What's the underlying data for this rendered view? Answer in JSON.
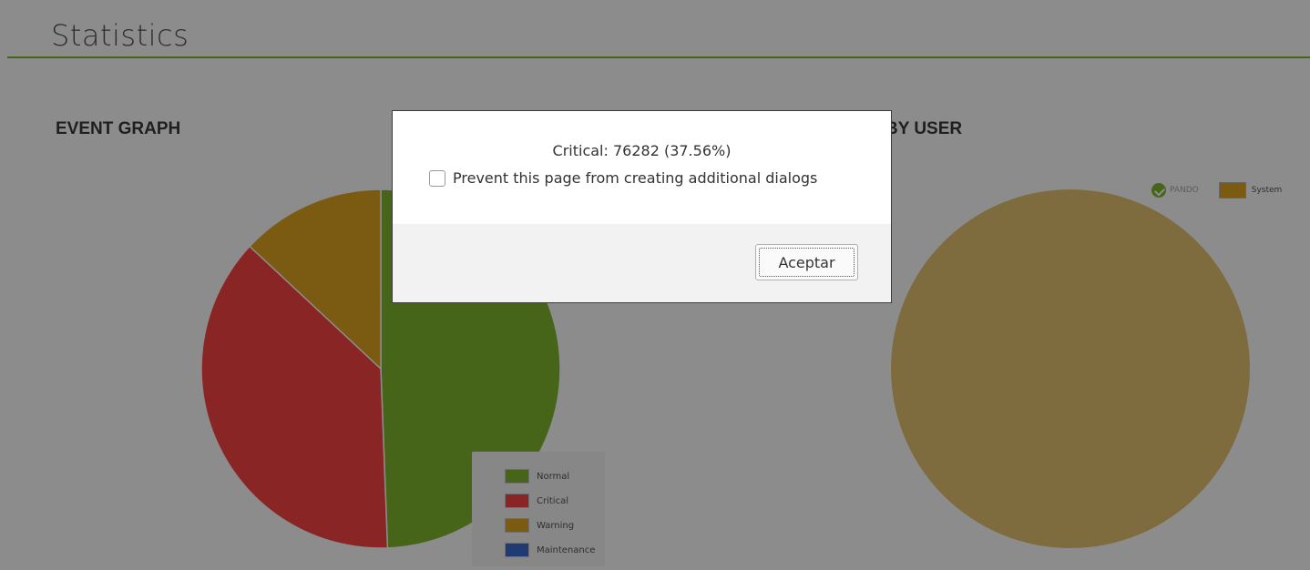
{
  "page": {
    "title": "Statistics",
    "accent_color": "#82b92e"
  },
  "sections": {
    "event_graph_title": "EVENT GRAPH",
    "by_user_title": "BY USER"
  },
  "chart_data": [
    {
      "type": "pie",
      "title": "EVENT GRAPH",
      "categories": [
        "Normal",
        "Critical",
        "Warning",
        "Maintenance"
      ],
      "values": [
        49.4,
        37.56,
        13.04,
        0
      ],
      "colors": [
        "#82b92e",
        "#fc4444",
        "#e0a521",
        "#3b6bd4"
      ],
      "legend_position": "bottom-right"
    },
    {
      "type": "pie",
      "title": "BY USER",
      "categories": [
        "System"
      ],
      "values": [
        100
      ],
      "colors": [
        "#e8c571"
      ],
      "legend_position": "top-right"
    }
  ],
  "user_legend": {
    "muted_label": "PANDO",
    "series_label": "System",
    "icon": "pandora-logo-icon"
  },
  "dialog": {
    "message": "Critical: 76282 (37.56%)",
    "checkbox_label": "Prevent this page from creating additional dialogs",
    "checkbox_checked": false,
    "button_label": "Aceptar"
  }
}
